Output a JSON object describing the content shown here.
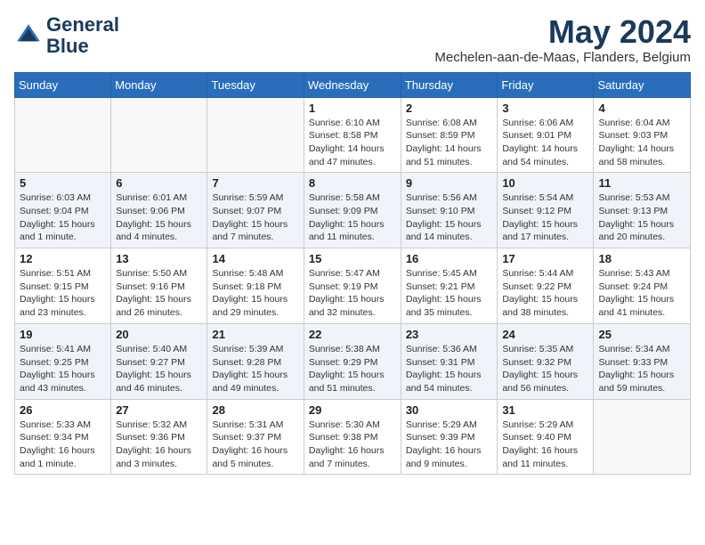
{
  "header": {
    "logo_line1": "General",
    "logo_line2": "Blue",
    "month_title": "May 2024",
    "location": "Mechelen-aan-de-Maas, Flanders, Belgium"
  },
  "days_of_week": [
    "Sunday",
    "Monday",
    "Tuesday",
    "Wednesday",
    "Thursday",
    "Friday",
    "Saturday"
  ],
  "weeks": [
    [
      {
        "day": "",
        "content": ""
      },
      {
        "day": "",
        "content": ""
      },
      {
        "day": "",
        "content": ""
      },
      {
        "day": "1",
        "content": "Sunrise: 6:10 AM\nSunset: 8:58 PM\nDaylight: 14 hours\nand 47 minutes."
      },
      {
        "day": "2",
        "content": "Sunrise: 6:08 AM\nSunset: 8:59 PM\nDaylight: 14 hours\nand 51 minutes."
      },
      {
        "day": "3",
        "content": "Sunrise: 6:06 AM\nSunset: 9:01 PM\nDaylight: 14 hours\nand 54 minutes."
      },
      {
        "day": "4",
        "content": "Sunrise: 6:04 AM\nSunset: 9:03 PM\nDaylight: 14 hours\nand 58 minutes."
      }
    ],
    [
      {
        "day": "5",
        "content": "Sunrise: 6:03 AM\nSunset: 9:04 PM\nDaylight: 15 hours\nand 1 minute."
      },
      {
        "day": "6",
        "content": "Sunrise: 6:01 AM\nSunset: 9:06 PM\nDaylight: 15 hours\nand 4 minutes."
      },
      {
        "day": "7",
        "content": "Sunrise: 5:59 AM\nSunset: 9:07 PM\nDaylight: 15 hours\nand 7 minutes."
      },
      {
        "day": "8",
        "content": "Sunrise: 5:58 AM\nSunset: 9:09 PM\nDaylight: 15 hours\nand 11 minutes."
      },
      {
        "day": "9",
        "content": "Sunrise: 5:56 AM\nSunset: 9:10 PM\nDaylight: 15 hours\nand 14 minutes."
      },
      {
        "day": "10",
        "content": "Sunrise: 5:54 AM\nSunset: 9:12 PM\nDaylight: 15 hours\nand 17 minutes."
      },
      {
        "day": "11",
        "content": "Sunrise: 5:53 AM\nSunset: 9:13 PM\nDaylight: 15 hours\nand 20 minutes."
      }
    ],
    [
      {
        "day": "12",
        "content": "Sunrise: 5:51 AM\nSunset: 9:15 PM\nDaylight: 15 hours\nand 23 minutes."
      },
      {
        "day": "13",
        "content": "Sunrise: 5:50 AM\nSunset: 9:16 PM\nDaylight: 15 hours\nand 26 minutes."
      },
      {
        "day": "14",
        "content": "Sunrise: 5:48 AM\nSunset: 9:18 PM\nDaylight: 15 hours\nand 29 minutes."
      },
      {
        "day": "15",
        "content": "Sunrise: 5:47 AM\nSunset: 9:19 PM\nDaylight: 15 hours\nand 32 minutes."
      },
      {
        "day": "16",
        "content": "Sunrise: 5:45 AM\nSunset: 9:21 PM\nDaylight: 15 hours\nand 35 minutes."
      },
      {
        "day": "17",
        "content": "Sunrise: 5:44 AM\nSunset: 9:22 PM\nDaylight: 15 hours\nand 38 minutes."
      },
      {
        "day": "18",
        "content": "Sunrise: 5:43 AM\nSunset: 9:24 PM\nDaylight: 15 hours\nand 41 minutes."
      }
    ],
    [
      {
        "day": "19",
        "content": "Sunrise: 5:41 AM\nSunset: 9:25 PM\nDaylight: 15 hours\nand 43 minutes."
      },
      {
        "day": "20",
        "content": "Sunrise: 5:40 AM\nSunset: 9:27 PM\nDaylight: 15 hours\nand 46 minutes."
      },
      {
        "day": "21",
        "content": "Sunrise: 5:39 AM\nSunset: 9:28 PM\nDaylight: 15 hours\nand 49 minutes."
      },
      {
        "day": "22",
        "content": "Sunrise: 5:38 AM\nSunset: 9:29 PM\nDaylight: 15 hours\nand 51 minutes."
      },
      {
        "day": "23",
        "content": "Sunrise: 5:36 AM\nSunset: 9:31 PM\nDaylight: 15 hours\nand 54 minutes."
      },
      {
        "day": "24",
        "content": "Sunrise: 5:35 AM\nSunset: 9:32 PM\nDaylight: 15 hours\nand 56 minutes."
      },
      {
        "day": "25",
        "content": "Sunrise: 5:34 AM\nSunset: 9:33 PM\nDaylight: 15 hours\nand 59 minutes."
      }
    ],
    [
      {
        "day": "26",
        "content": "Sunrise: 5:33 AM\nSunset: 9:34 PM\nDaylight: 16 hours\nand 1 minute."
      },
      {
        "day": "27",
        "content": "Sunrise: 5:32 AM\nSunset: 9:36 PM\nDaylight: 16 hours\nand 3 minutes."
      },
      {
        "day": "28",
        "content": "Sunrise: 5:31 AM\nSunset: 9:37 PM\nDaylight: 16 hours\nand 5 minutes."
      },
      {
        "day": "29",
        "content": "Sunrise: 5:30 AM\nSunset: 9:38 PM\nDaylight: 16 hours\nand 7 minutes."
      },
      {
        "day": "30",
        "content": "Sunrise: 5:29 AM\nSunset: 9:39 PM\nDaylight: 16 hours\nand 9 minutes."
      },
      {
        "day": "31",
        "content": "Sunrise: 5:29 AM\nSunset: 9:40 PM\nDaylight: 16 hours\nand 11 minutes."
      },
      {
        "day": "",
        "content": ""
      }
    ]
  ]
}
